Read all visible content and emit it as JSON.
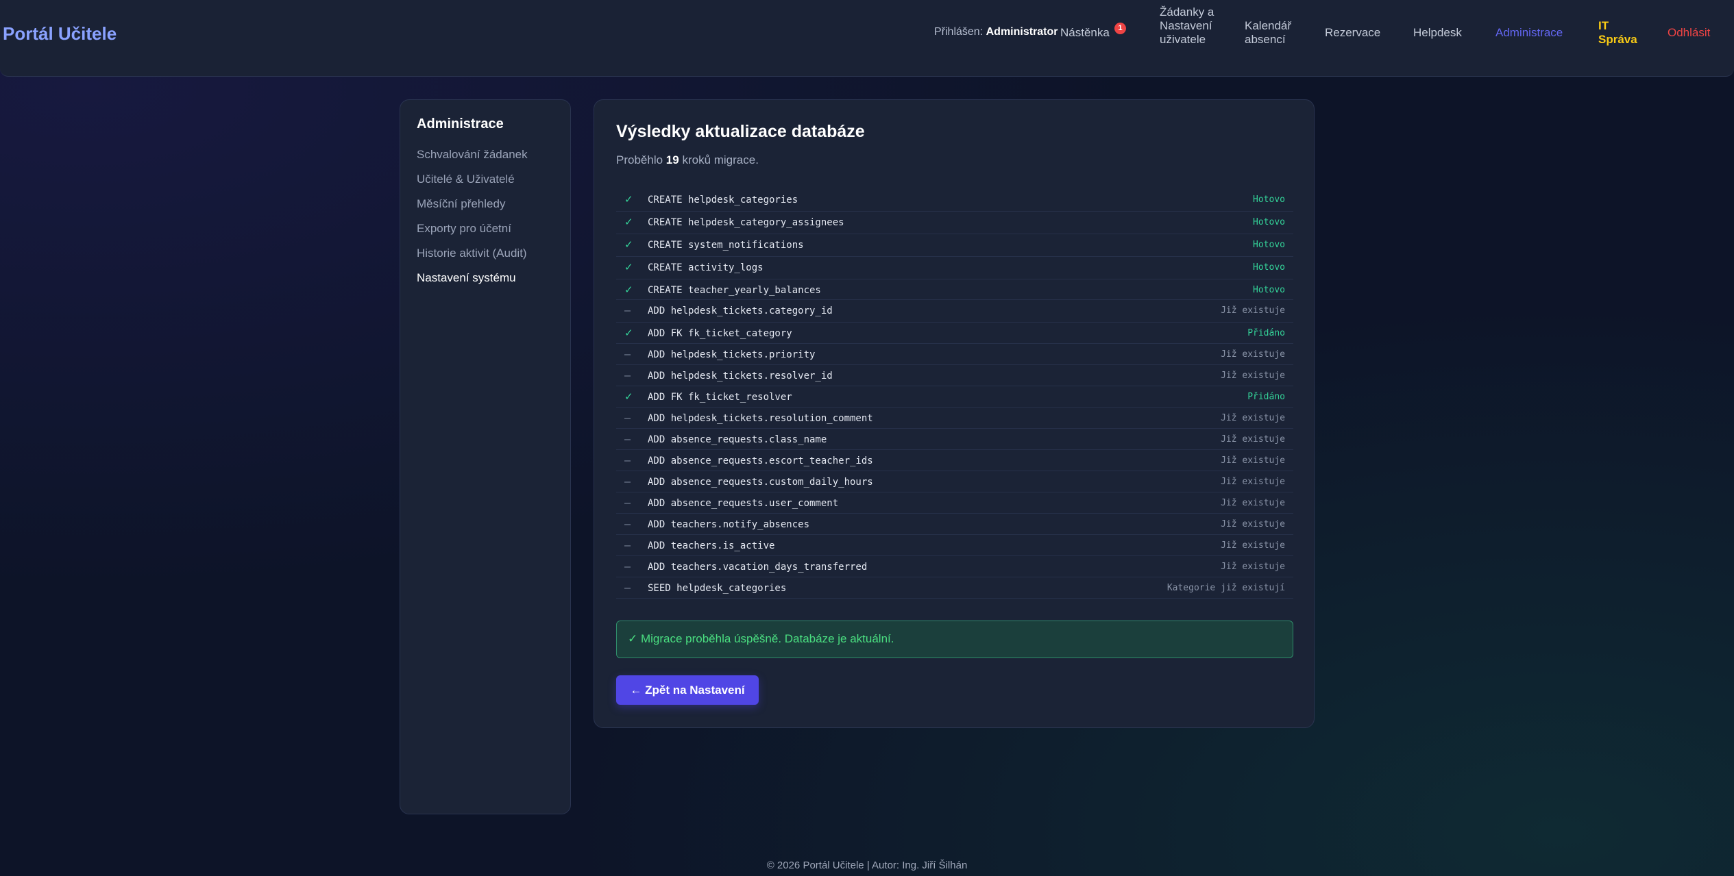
{
  "header": {
    "brand": "Portál Učitele",
    "logged_prefix": "Přihlášen:",
    "logged_user": "Administrator",
    "nav": {
      "dashboard": "Nástěnka",
      "dashboard_badge": "1",
      "requests": "Žádanky a Nastavení uživatele",
      "calendar": "Kalendář absencí",
      "reservations": "Rezervace",
      "helpdesk": "Helpdesk",
      "admin": "Administrace",
      "it": "IT Správa",
      "logout": "Odhlásit"
    },
    "colors": {
      "active": "#6366f1",
      "it": "#facc15",
      "logout": "#ef4444"
    }
  },
  "sidebar": {
    "title": "Administrace",
    "items": [
      {
        "label": "Schvalování žádanek"
      },
      {
        "label": "Učitelé & Uživatelé"
      },
      {
        "label": "Měsíční přehledy"
      },
      {
        "label": "Exporty pro účetní"
      },
      {
        "label": "Historie aktivit (Audit)"
      },
      {
        "label": "Nastavení systému"
      }
    ]
  },
  "main": {
    "title": "Výsledky aktualizace databáze",
    "sub_prefix": "Proběhlo",
    "sub_count": "19",
    "sub_suffix": "kroků migrace.",
    "steps": [
      {
        "icon": "✓",
        "kind": "ok",
        "cmd": "CREATE helpdesk_categories",
        "status": "Hotovo"
      },
      {
        "icon": "✓",
        "kind": "ok",
        "cmd": "CREATE helpdesk_category_assignees",
        "status": "Hotovo"
      },
      {
        "icon": "✓",
        "kind": "ok",
        "cmd": "CREATE system_notifications",
        "status": "Hotovo"
      },
      {
        "icon": "✓",
        "kind": "ok",
        "cmd": "CREATE activity_logs",
        "status": "Hotovo"
      },
      {
        "icon": "✓",
        "kind": "ok",
        "cmd": "CREATE teacher_yearly_balances",
        "status": "Hotovo"
      },
      {
        "icon": "–",
        "kind": "skip",
        "cmd": "ADD helpdesk_tickets.category_id",
        "status": "Již existuje"
      },
      {
        "icon": "✓",
        "kind": "ok",
        "cmd": "ADD FK fk_ticket_category",
        "status": "Přidáno"
      },
      {
        "icon": "–",
        "kind": "skip",
        "cmd": "ADD helpdesk_tickets.priority",
        "status": "Již existuje"
      },
      {
        "icon": "–",
        "kind": "skip",
        "cmd": "ADD helpdesk_tickets.resolver_id",
        "status": "Již existuje"
      },
      {
        "icon": "✓",
        "kind": "ok",
        "cmd": "ADD FK fk_ticket_resolver",
        "status": "Přidáno"
      },
      {
        "icon": "–",
        "kind": "skip",
        "cmd": "ADD helpdesk_tickets.resolution_comment",
        "status": "Již existuje"
      },
      {
        "icon": "–",
        "kind": "skip",
        "cmd": "ADD absence_requests.class_name",
        "status": "Již existuje"
      },
      {
        "icon": "–",
        "kind": "skip",
        "cmd": "ADD absence_requests.escort_teacher_ids",
        "status": "Již existuje"
      },
      {
        "icon": "–",
        "kind": "skip",
        "cmd": "ADD absence_requests.custom_daily_hours",
        "status": "Již existuje"
      },
      {
        "icon": "–",
        "kind": "skip",
        "cmd": "ADD absence_requests.user_comment",
        "status": "Již existuje"
      },
      {
        "icon": "–",
        "kind": "skip",
        "cmd": "ADD teachers.notify_absences",
        "status": "Již existuje"
      },
      {
        "icon": "–",
        "kind": "skip",
        "cmd": "ADD teachers.is_active",
        "status": "Již existuje"
      },
      {
        "icon": "–",
        "kind": "skip",
        "cmd": "ADD teachers.vacation_days_transferred",
        "status": "Již existuje"
      },
      {
        "icon": "–",
        "kind": "skip",
        "cmd": "SEED helpdesk_categories",
        "status": "Kategorie již existují"
      }
    ],
    "success_message": "✓ Migrace proběhla úspěšně. Databáze je aktuální.",
    "back_button": "← Zpět na Nastavení"
  },
  "footer": "© 2026 Portál Učitele | Autor: Ing. Jiří Šilhán"
}
